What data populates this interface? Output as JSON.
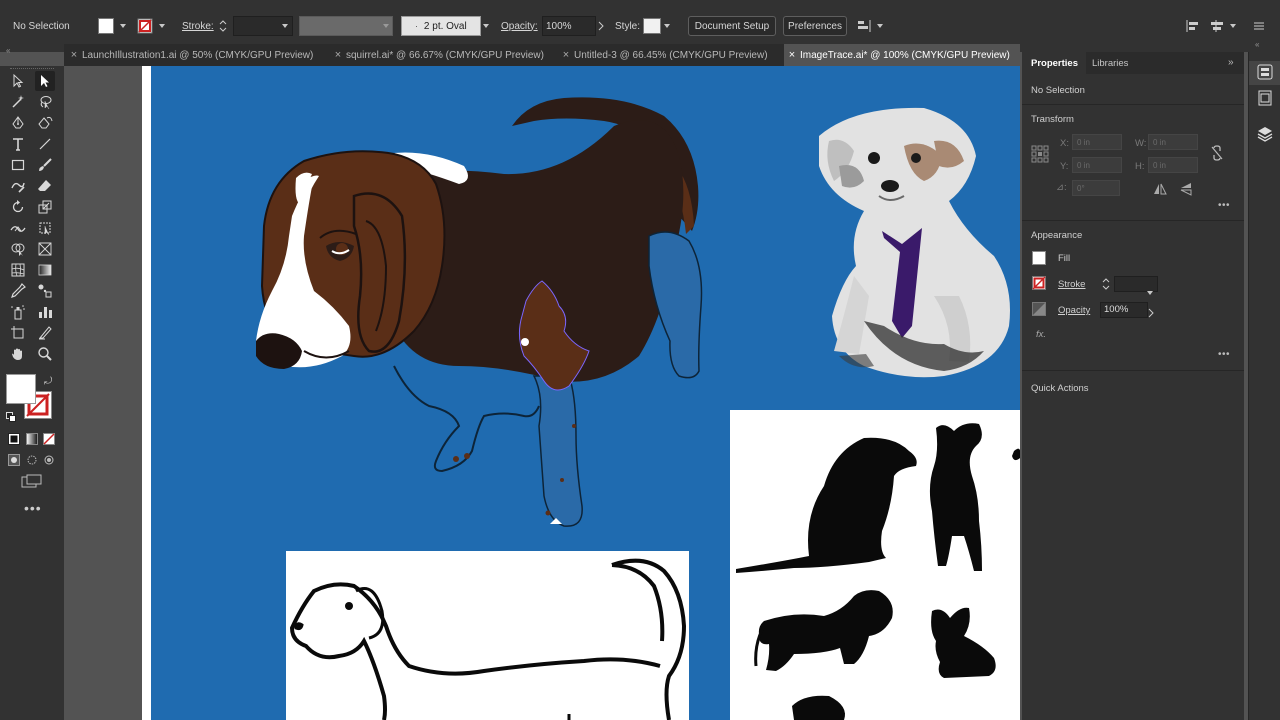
{
  "control_bar": {
    "selection_label": "No Selection",
    "stroke_label": "Stroke:",
    "brush_label": "2 pt. Oval",
    "opacity_label": "Opacity:",
    "opacity_value": "100%",
    "style_label": "Style:",
    "document_setup_label": "Document Setup",
    "preferences_label": "Preferences"
  },
  "tabs": [
    {
      "label": "LaunchIllustration1.ai @ 50% (CMYK/GPU Preview)",
      "active": false
    },
    {
      "label": "squirrel.ai* @ 66.67% (CMYK/GPU Preview)",
      "active": false
    },
    {
      "label": "Untitled-3 @ 66.45% (CMYK/GPU Preview)",
      "active": false
    },
    {
      "label": "ImageTrace.ai* @ 100% (CMYK/GPU Preview)",
      "active": true
    }
  ],
  "panel": {
    "tab_properties": "Properties",
    "tab_libraries": "Libraries",
    "selection_status": "No Selection",
    "transform_title": "Transform",
    "x_label": "X:",
    "y_label": "Y:",
    "w_label": "W:",
    "h_label": "H:",
    "rotate_label": "⊿:",
    "field_zero": "0 in",
    "angle_zero": "0°",
    "appearance_title": "Appearance",
    "fill_label": "Fill",
    "stroke_label": "Stroke",
    "opacity_label": "Opacity",
    "opacity_value": "100%",
    "fx_label": "fx.",
    "quick_actions_title": "Quick Actions"
  },
  "colors": {
    "artboard_blue": "#1f6bb0",
    "beagle_brown": "#5a2e17",
    "beagle_dark": "#2c1c17"
  }
}
